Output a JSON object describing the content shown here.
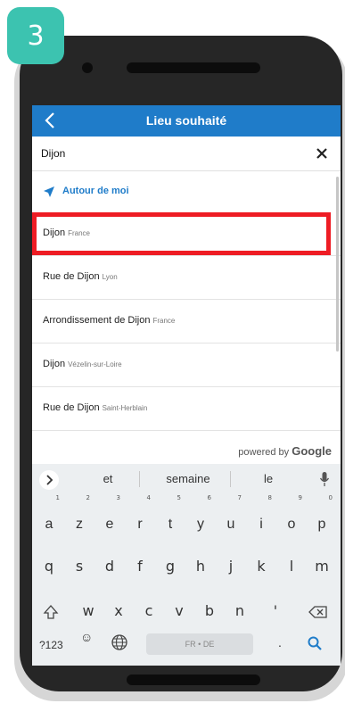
{
  "step_badge": "3",
  "header": {
    "title": "Lieu souhaité"
  },
  "search": {
    "value": "Dijon"
  },
  "near_me": {
    "label": "Autour de moi"
  },
  "results": [
    {
      "name": "Dijon",
      "sub": "France"
    },
    {
      "name": "Rue de Dijon",
      "sub": "Lyon"
    },
    {
      "name": "Arrondissement de Dijon",
      "sub": "France"
    },
    {
      "name": "Dijon",
      "sub": "Vézelin-sur-Loire"
    },
    {
      "name": "Rue de Dijon",
      "sub": "Saint-Herblain"
    }
  ],
  "attribution": {
    "prefix": "powered by",
    "brand": "Google"
  },
  "keyboard": {
    "suggestions": [
      "et",
      "semaine",
      "le"
    ],
    "row1": [
      {
        "k": "a",
        "h": "1"
      },
      {
        "k": "z",
        "h": "2"
      },
      {
        "k": "e",
        "h": "3"
      },
      {
        "k": "r",
        "h": "4"
      },
      {
        "k": "t",
        "h": "5"
      },
      {
        "k": "y",
        "h": "6"
      },
      {
        "k": "u",
        "h": "7"
      },
      {
        "k": "i",
        "h": "8"
      },
      {
        "k": "o",
        "h": "9"
      },
      {
        "k": "p",
        "h": "0"
      }
    ],
    "row2": [
      "q",
      "s",
      "d",
      "f",
      "g",
      "h",
      "j",
      "k",
      "l",
      "m"
    ],
    "row3": [
      "w",
      "x",
      "c",
      "v",
      "b",
      "n",
      "'"
    ],
    "sym": "?123",
    "space": "FR • DE",
    "period": "."
  },
  "colors": {
    "accent": "#1f7cc9",
    "highlight": "#ee1c24",
    "badge": "#3cc3b0"
  }
}
